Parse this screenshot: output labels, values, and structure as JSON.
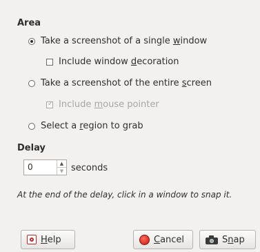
{
  "area": {
    "heading": "Area",
    "single_window": {
      "prefix": "Take a screenshot of a single ",
      "mnemonic": "w",
      "suffix": "indow",
      "selected": true
    },
    "include_decoration": {
      "prefix": "Include window ",
      "mnemonic": "d",
      "suffix": "ecoration",
      "checked": false
    },
    "entire_screen": {
      "prefix": "Take a screenshot of the entire ",
      "mnemonic": "s",
      "suffix": "creen",
      "selected": false
    },
    "include_pointer": {
      "prefix": "Include ",
      "mnemonic": "m",
      "suffix": "ouse pointer",
      "checked": true,
      "disabled": true
    },
    "region": {
      "prefix": "Select a ",
      "mnemonic": "r",
      "suffix": "egion to grab",
      "selected": false
    }
  },
  "delay": {
    "heading": "Delay",
    "value": "0",
    "unit": "seconds",
    "hint": "At the end of the delay, click in a window to snap it."
  },
  "buttons": {
    "help": {
      "mnemonic": "H",
      "rest": "elp",
      "icon": "help-icon"
    },
    "cancel": {
      "mnemonic": "C",
      "rest": "ancel",
      "icon": "cancel-icon"
    },
    "snap": {
      "prefix": "S",
      "mnemonic": "n",
      "suffix": "ap",
      "icon": "camera-icon"
    }
  }
}
